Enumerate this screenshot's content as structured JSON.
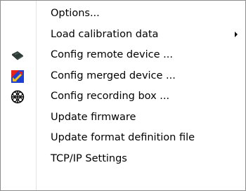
{
  "menu": {
    "items": [
      {
        "label": "Options...",
        "icon": "",
        "submenu": false
      },
      {
        "label": "Load calibration data",
        "icon": "",
        "submenu": true
      },
      {
        "label": "Config remote device ...",
        "icon": "remote-device-icon",
        "submenu": false
      },
      {
        "label": "Config merged device ...",
        "icon": "merged-device-icon",
        "submenu": false
      },
      {
        "label": "Config recording box ...",
        "icon": "recording-box-icon",
        "submenu": false
      },
      {
        "label": "Update firmware",
        "icon": "",
        "submenu": false
      },
      {
        "label": "Update format definition file",
        "icon": "",
        "submenu": false
      },
      {
        "label": "TCP/IP Settings",
        "icon": "",
        "submenu": false
      }
    ]
  },
  "colors": {
    "border": "#8c8c8c",
    "separator": "#e3e3e3",
    "text": "#000000",
    "icon_red": "#e8221b",
    "icon_yellow": "#f7c21c",
    "icon_blue": "#1f3fd0",
    "icon_dark": "#2e3a36"
  }
}
